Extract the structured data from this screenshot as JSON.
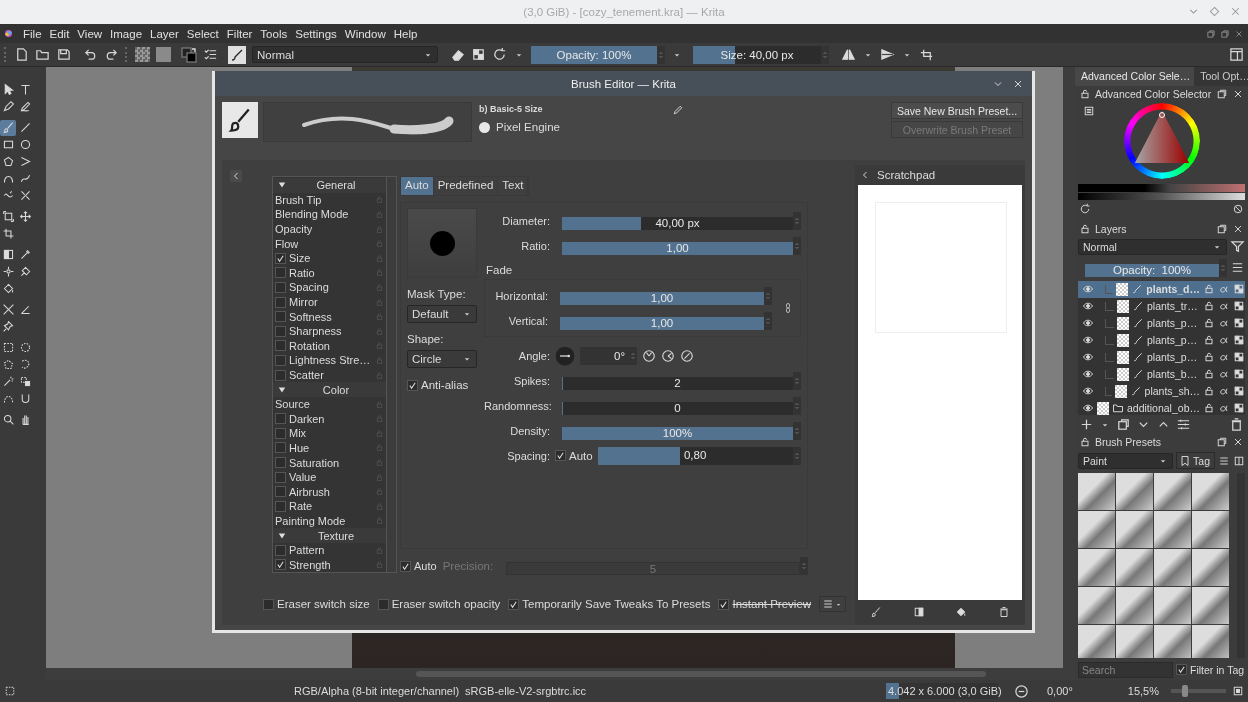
{
  "window": {
    "title": "(3,0 GiB) - [cozy_tenement.kra] — Krita"
  },
  "menu": [
    "File",
    "Edit",
    "View",
    "Image",
    "Layer",
    "Select",
    "Filter",
    "Tools",
    "Settings",
    "Window",
    "Help"
  ],
  "toolbar": {
    "blend_mode": "Normal",
    "opacity": {
      "label": "Opacity: 100%",
      "level": 1
    },
    "size": {
      "label": "Size: 40,00 px",
      "level": 0.33
    }
  },
  "toolbox": {
    "tools": [
      {
        "selected": false
      },
      {
        "selected": false
      },
      {
        "selected": false
      },
      {
        "selected": false
      },
      {
        "selected": true
      },
      {
        "selected": false
      },
      {
        "selected": false
      },
      {
        "selected": false
      },
      {
        "selected": false
      },
      {
        "selected": false
      },
      {
        "selected": false
      },
      {
        "selected": false
      },
      {
        "selected": false
      },
      {
        "selected": false
      },
      {
        "selected": false
      },
      {
        "selected": false
      },
      {
        "selected": false
      },
      {
        "selected": false
      },
      {
        "selected": false
      },
      {
        "selected": false
      },
      {
        "selected": false
      },
      {
        "selected": false
      },
      {
        "selected": false
      },
      {
        "selected": false
      },
      {
        "selected": false
      },
      {
        "selected": false
      },
      {
        "selected": false
      },
      {
        "selected": false
      },
      {
        "selected": false
      },
      {
        "selected": false
      },
      {
        "selected": false
      },
      {
        "selected": false
      },
      {
        "selected": false
      },
      {
        "selected": false
      },
      {
        "selected": false
      }
    ]
  },
  "brush_editor": {
    "title": "Brush Editor — Krita",
    "preset_name": "b) Basic-5 Size",
    "engine": "Pixel Engine",
    "buttons": [
      {
        "label": "Save New Brush Preset...",
        "disabled": false
      },
      {
        "label": "Overwrite Brush Preset",
        "disabled": true
      }
    ],
    "options": [
      {
        "kind": "header",
        "label": "General",
        "expanded": true
      },
      {
        "kind": "item",
        "label": "Brush Tip"
      },
      {
        "kind": "item",
        "label": "Blending Mode"
      },
      {
        "kind": "item",
        "label": "Opacity"
      },
      {
        "kind": "item",
        "label": "Flow"
      },
      {
        "kind": "check",
        "label": "Size",
        "checked": true
      },
      {
        "kind": "check",
        "label": "Ratio",
        "checked": false
      },
      {
        "kind": "check",
        "label": "Spacing",
        "checked": false
      },
      {
        "kind": "check",
        "label": "Mirror",
        "checked": false
      },
      {
        "kind": "check",
        "label": "Softness",
        "checked": false
      },
      {
        "kind": "check",
        "label": "Sharpness",
        "checked": false
      },
      {
        "kind": "check",
        "label": "Rotation",
        "checked": false
      },
      {
        "kind": "check",
        "label": "Lightness Stre…",
        "checked": false
      },
      {
        "kind": "check",
        "label": "Scatter",
        "checked": false
      },
      {
        "kind": "header",
        "label": "Color",
        "expanded": true
      },
      {
        "kind": "item",
        "label": "Source"
      },
      {
        "kind": "check",
        "label": "Darken",
        "checked": false
      },
      {
        "kind": "check",
        "label": "Mix",
        "checked": false
      },
      {
        "kind": "check",
        "label": "Hue",
        "checked": false
      },
      {
        "kind": "check",
        "label": "Saturation",
        "checked": false
      },
      {
        "kind": "check",
        "label": "Value",
        "checked": false
      },
      {
        "kind": "check",
        "label": "Airbrush",
        "checked": false
      },
      {
        "kind": "check",
        "label": "Rate",
        "checked": false
      },
      {
        "kind": "item",
        "label": "Painting Mode"
      },
      {
        "kind": "header",
        "label": "Texture",
        "expanded": true
      },
      {
        "kind": "check",
        "label": "Pattern",
        "checked": false
      },
      {
        "kind": "check",
        "label": "Strength",
        "checked": true
      }
    ],
    "tabs": [
      {
        "label": "Auto",
        "selected": true
      },
      {
        "label": "Predefined",
        "selected": false
      },
      {
        "label": "Text",
        "selected": false
      }
    ],
    "mask_type": {
      "label": "Mask Type:",
      "value": "Default"
    },
    "shape": {
      "label": "Shape:",
      "value": "Circle"
    },
    "anti_alias": {
      "label": "Anti-alias",
      "checked": true
    },
    "params": [
      {
        "label": "Diameter:",
        "value": "40,00 px",
        "level": 0.34
      },
      {
        "label": "Ratio:",
        "value": "1,00",
        "level": 1
      }
    ],
    "fade": {
      "label": "Fade",
      "params": [
        {
          "label": "Horizontal:",
          "value": "1,00",
          "level": 1
        },
        {
          "label": "Vertical:",
          "value": "1,00",
          "level": 1
        }
      ]
    },
    "angle": {
      "label": "Angle:",
      "value": "0°"
    },
    "params2": [
      {
        "label": "Spikes:",
        "value": "2",
        "level": 0
      },
      {
        "label": "Randomness:",
        "value": "0",
        "level": 0
      },
      {
        "label": "Density:",
        "value": "100%",
        "level": 1
      }
    ],
    "spacing": {
      "label": "Spacing:",
      "auto": {
        "label": "Auto",
        "checked": true
      },
      "value": "0,80",
      "level": 0.42
    },
    "precision": {
      "auto": {
        "label": "Auto",
        "checked": true
      },
      "label": "Precision:",
      "value": "5",
      "disabled": true
    },
    "scratchpad": {
      "title": "Scratchpad"
    },
    "bottom_options": [
      {
        "label": "Eraser switch size",
        "checked": false,
        "strikethrough": false
      },
      {
        "label": "Eraser switch opacity",
        "checked": false,
        "strikethrough": false
      },
      {
        "label": "Temporarily Save Tweaks To Presets",
        "checked": true,
        "strikethrough": false
      },
      {
        "label": "Instant Preview",
        "checked": true,
        "strikethrough": true
      }
    ]
  },
  "dock": {
    "tabs": [
      {
        "label": "Advanced Color Sele…",
        "selected": true
      },
      {
        "label": "Tool Opt…",
        "selected": false
      }
    ],
    "color_selector": {
      "title": "Advanced Color Selector"
    },
    "layers": {
      "title": "Layers",
      "blend_mode": "Normal",
      "opacity": {
        "label": "Opacity:  100%",
        "level": 1
      },
      "rows": [
        {
          "name": "plants_d…",
          "kind": "layer",
          "selected": true
        },
        {
          "name": "plants_tr…",
          "kind": "layer",
          "selected": false
        },
        {
          "name": "plants_p…",
          "kind": "layer",
          "selected": false
        },
        {
          "name": "plants_p…",
          "kind": "layer",
          "selected": false
        },
        {
          "name": "plants_p…",
          "kind": "layer",
          "selected": false
        },
        {
          "name": "plants_b…",
          "kind": "layer",
          "selected": false
        },
        {
          "name": "plants_sh…",
          "kind": "layer",
          "selected": false
        },
        {
          "name": "additional_ob…",
          "kind": "group",
          "selected": false
        }
      ]
    },
    "brush_presets": {
      "title": "Brush Presets",
      "tag_filter": "Paint",
      "tag_button": "Tag",
      "search": {
        "placeholder": "Search"
      },
      "filter_in_tag": {
        "label": "Filter in Tag",
        "checked": true
      }
    }
  },
  "status_bar": {
    "color_model": "RGB/Alpha (8-bit integer/channel)",
    "profile": "sRGB-elle-V2-srgbtrc.icc",
    "image_size": {
      "text": "4.042 x 6.000 (3,0 GiB)",
      "level": 0.12
    },
    "rotation": "0,00°",
    "zoom": {
      "text": "15,5%",
      "level": 0.25
    }
  }
}
